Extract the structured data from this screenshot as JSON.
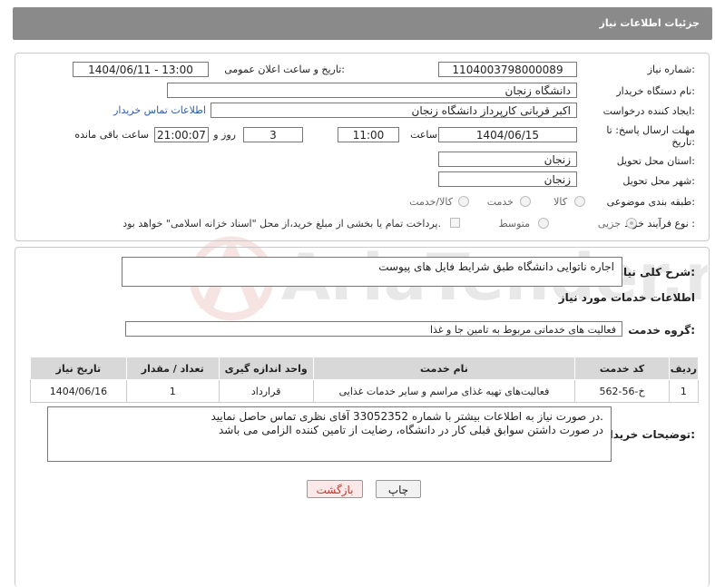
{
  "header": {
    "title": "جزئیات اطلاعات نیاز"
  },
  "form": {
    "need_number_label": "شماره نیاز:",
    "need_number": "1104003798000089",
    "announce_label": "تاریخ و ساعت اعلان عمومی:",
    "announce_value": "1404/06/11 - 13:00",
    "buyer_org_label": "نام دستگاه خریدار:",
    "buyer_org": "دانشگاه زنجان",
    "creator_label": "ایجاد کننده درخواست:",
    "creator": "اکبر قربانی کارپرداز دانشگاه زنجان",
    "contact_link": "اطلاعات تماس خریدار",
    "deadline_label": "مهلت ارسال پاسخ: تا تاریخ:",
    "deadline_date": "1404/06/15",
    "time_label": "ساعت",
    "deadline_time": "11:00",
    "days_value": "3",
    "days_label": "روز و",
    "remaining_time": "21:00:07",
    "remaining_label": "ساعت باقی مانده",
    "province_label": "استان محل تحویل:",
    "province": "زنجان",
    "city_label": "شهر محل تحویل:",
    "city": "زنجان",
    "category_label": "طبقه بندی موضوعی:",
    "category_options": [
      "کالا",
      "خدمت",
      "کالا/خدمت"
    ],
    "purchase_type_label": "نوع فرآیند خرید :",
    "purchase_options": [
      "جزیی",
      "متوسط"
    ],
    "payment_note": "پرداخت تمام یا بخشی از مبلغ خرید،از محل \"اسناد خزانه اسلامی\" خواهد بود."
  },
  "description": {
    "label": "شرح کلی نیاز:",
    "text": "اجاره ناتوایی دانشگاه طبق شرایط فایل های پیوست"
  },
  "services": {
    "title": "اطلاعات خدمات مورد نیاز",
    "group_label": "گروه خدمت:",
    "group_value": "فعالیت های خدماتی مربوط به تامین جا و غذا",
    "columns": [
      "ردیف",
      "کد خدمت",
      "نام خدمت",
      "واحد اندازه گیری",
      "تعداد / مقدار",
      "تاریخ نیاز"
    ],
    "rows": [
      [
        "1",
        "خ-56-562",
        "فعالیت‌های تهیه غذای مراسم و سایر خدمات غذایی",
        "قرارداد",
        "1",
        "1404/06/16"
      ]
    ]
  },
  "buyer_notes": {
    "label": "توضیحات خریدار:",
    "line1": "در صورت نیاز به اطلاعات بیشتر با شماره 33052352 آقای نظری تماس حاصل نمایید.",
    "line2": "در صورت داشتن سوابق قبلی کار در دانشگاه، رضایت از تامین کننده الزامی می باشد"
  },
  "buttons": {
    "print": "چاپ",
    "back": "بازگشت"
  },
  "watermark": "AriaTender.neT",
  "colors": {
    "header_bg": "#8a8a8a",
    "back_button_text": "#c0392b",
    "link": "#2a5db0"
  }
}
